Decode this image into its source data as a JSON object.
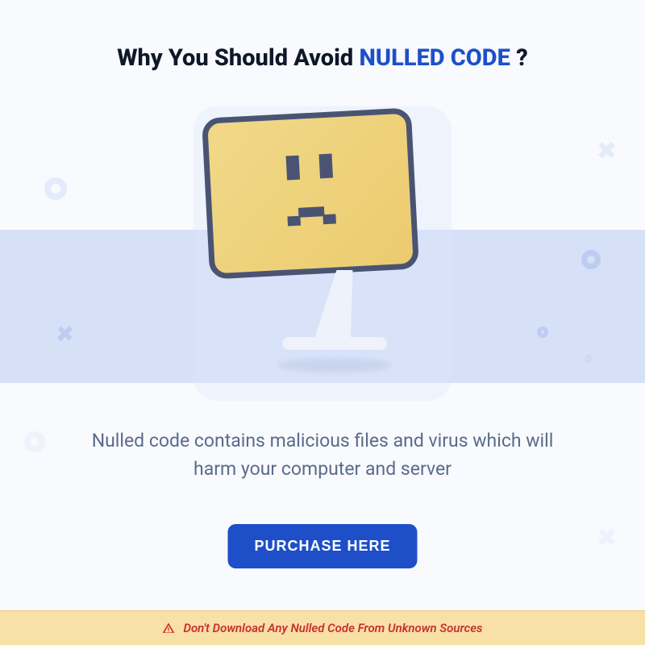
{
  "title": {
    "prefix": "Why You Should Avoid ",
    "highlight": "NULLED CODE",
    "suffix": " ?"
  },
  "description": "Nulled code contains malicious files and virus which will harm your computer and server",
  "cta": {
    "label": "PURCHASE HERE"
  },
  "warning": {
    "text": "Don't Download Any Nulled Code From Unknown Sources"
  }
}
